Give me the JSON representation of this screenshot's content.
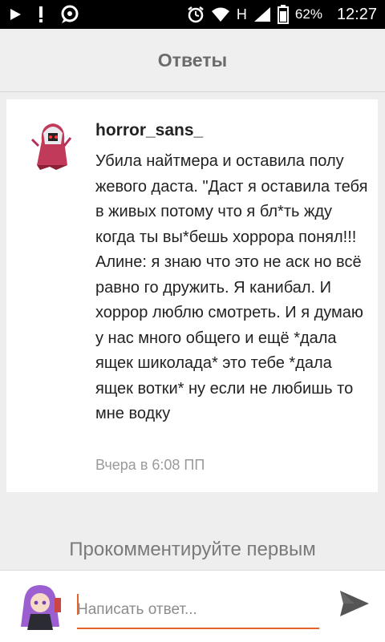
{
  "status_bar": {
    "network_label": "H",
    "battery": "62%",
    "time": "12:27"
  },
  "header": {
    "title": "Ответы"
  },
  "comment": {
    "author": "horror_sans_",
    "text": "Убила найтмера и оставила полу жевого даста. \"Даст я оставила тебя в живых потому что я бл*ть жду когда ты вы*бешь хоррора понял!!!\nАлине: я знаю что это не аск но всё равно го дружить. Я канибал. И хоррор люблю смотреть. И я думаю у нас много общего и ещё *дала ящек шиколада* это тебе *дала ящек вотки* ну если не любишь то мне водку",
    "time": "Вчера в 6:08 ПП"
  },
  "empty_note": "Прокомментируйте первым",
  "composer": {
    "placeholder": "Написать ответ..."
  },
  "colors": {
    "accent": "#e8622b",
    "title_gray": "#6b6b6b",
    "time_gray": "#9a9a9a"
  },
  "icons": [
    "play-icon",
    "alert-icon",
    "chat-icon",
    "alarm-icon",
    "wifi-icon",
    "signal-icon",
    "battery-icon",
    "send-icon"
  ]
}
